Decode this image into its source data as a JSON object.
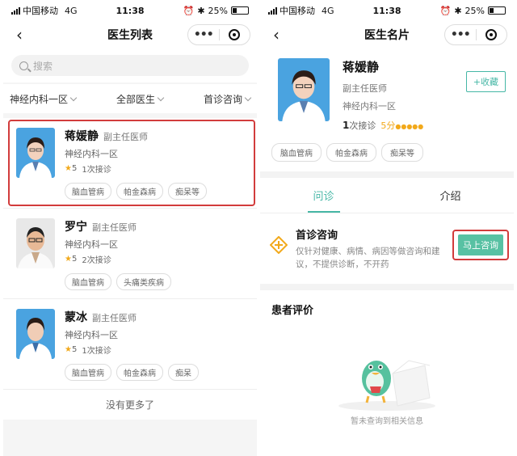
{
  "status": {
    "carrier": "中国移动",
    "network": "4G",
    "time": "11:38",
    "battery": "25%"
  },
  "left": {
    "title": "医生列表",
    "search_placeholder": "搜索",
    "filters": [
      "神经内科一区",
      "全部医生",
      "首诊咨询"
    ],
    "doctors": [
      {
        "name": "蒋媛静",
        "title": "副主任医师",
        "dept": "神经内科一区",
        "rating": "5",
        "visits": "1次接诊",
        "tags": [
          "脑血管病",
          "帕金森病",
          "痴呆等"
        ]
      },
      {
        "name": "罗宁",
        "title": "副主任医师",
        "dept": "神经内科一区",
        "rating": "5",
        "visits": "2次接诊",
        "tags": [
          "脑血管病",
          "头痛类疾病"
        ]
      },
      {
        "name": "蒙冰",
        "title": "副主任医师",
        "dept": "神经内科一区",
        "rating": "5",
        "visits": "1次接诊",
        "tags": [
          "脑血管病",
          "帕金森病",
          "痴呆"
        ]
      }
    ],
    "no_more": "没有更多了"
  },
  "right": {
    "title": "医生名片",
    "doctor": {
      "name": "蒋媛静",
      "title": "副主任医师",
      "dept": "神经内科一区",
      "visits_num": "1",
      "visits_label": "次接诊",
      "score": "5分",
      "stars": "●●●●●",
      "tags": [
        "脑血管病",
        "帕金森病",
        "痴呆等"
      ]
    },
    "fav_label": "+收藏",
    "tabs": [
      "问诊",
      "介绍"
    ],
    "consult": {
      "title": "首诊咨询",
      "desc": "仅针对健康、病情、病因等做咨询和建议，不提供诊断，不开药",
      "button": "马上咨询"
    },
    "reviews_title": "患者评价",
    "empty_text": "暂未查询到相关信息"
  },
  "colors": {
    "accent": "#46b7a6",
    "highlight": "#d23c3c",
    "star": "#f2a91b"
  }
}
